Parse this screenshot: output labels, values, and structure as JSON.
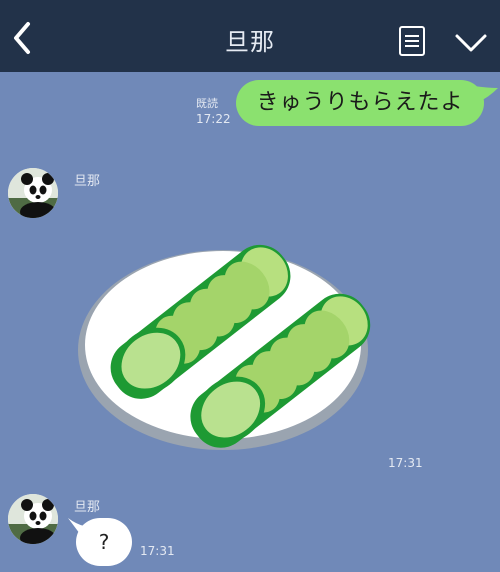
{
  "header": {
    "title": "旦那",
    "back_icon": "chevron-left-icon",
    "menu_icon": "menu-list-icon",
    "more_icon": "chevron-down-icon",
    "background": "#223249"
  },
  "chat": {
    "background": "#7089b8",
    "messages": [
      {
        "direction": "outgoing",
        "text": "きゅうりもらえたよ",
        "read_label": "既読",
        "time": "17:22",
        "bubble_color": "#8be16f"
      },
      {
        "direction": "incoming",
        "sender": "旦那",
        "type": "sticker",
        "sticker": "cucumber-plate-sticker",
        "time": "17:31"
      },
      {
        "direction": "incoming",
        "sender": "旦那",
        "text": "?",
        "time": "17:31",
        "bubble_color": "#ffffff"
      }
    ]
  }
}
